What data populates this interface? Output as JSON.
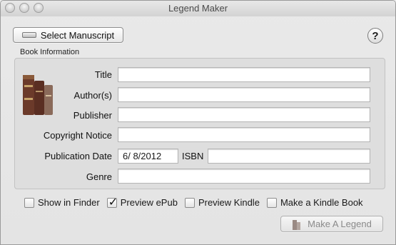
{
  "window": {
    "title": "Legend Maker"
  },
  "toolbar": {
    "select_label": "Select Manuscript",
    "help_label": "?"
  },
  "book_info": {
    "group_label": "Book Information",
    "title_label": "Title",
    "title_value": "",
    "authors_label": "Author(s)",
    "authors_value": "",
    "publisher_label": "Publisher",
    "publisher_value": "",
    "copyright_label": "Copyright Notice",
    "copyright_value": "",
    "pubdate_label": "Publication Date",
    "pubdate_value": "6/  8/2012",
    "isbn_label": "ISBN",
    "isbn_value": "",
    "genre_label": "Genre",
    "genre_value": ""
  },
  "options": [
    {
      "label": "Show in Finder",
      "checked": false
    },
    {
      "label": "Preview ePub",
      "checked": true
    },
    {
      "label": "Preview Kindle",
      "checked": false
    },
    {
      "label": "Make a Kindle Book",
      "checked": false
    }
  ],
  "actions": {
    "make_label": "Make A Legend",
    "make_enabled": false
  },
  "icons": {
    "books": "books-icon",
    "drive": "drive-icon",
    "help": "question-icon"
  }
}
